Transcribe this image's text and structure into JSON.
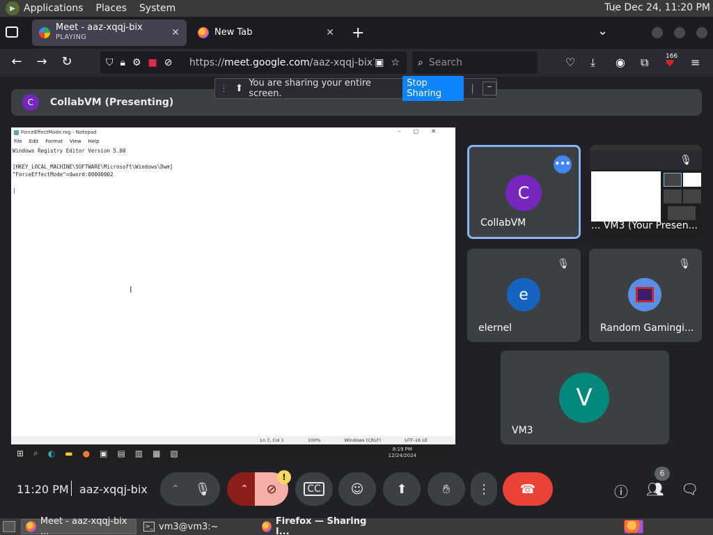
{
  "top_panel": {
    "menus": [
      "Applications",
      "Places",
      "System"
    ],
    "clock": "Tue Dec 24, 11:20 PM"
  },
  "browser": {
    "tabs": [
      {
        "title": "Meet - aaz-xqqj-bix",
        "subtitle": "PLAYING",
        "active": true
      },
      {
        "title": "New Tab",
        "active": false
      }
    ],
    "url_prefix": "https://",
    "url_host": "meet.google.com",
    "url_path": "/aaz-xqqj-bix?",
    "search_placeholder": "Search",
    "extensions_badge": "166"
  },
  "share_bar": {
    "message": "You are sharing your entire screen.",
    "stop_label": "Stop Sharing",
    "minimize_label": "–"
  },
  "presenting": {
    "avatar_letter": "C",
    "label": "CollabVM (Presenting)"
  },
  "shared_screen": {
    "window_title": "ForceEffectMode.reg - Notepad",
    "menu": [
      "File",
      "Edit",
      "Format",
      "View",
      "Help"
    ],
    "text": "Windows Registry Editor Version 5.00\n\n[HKEY_LOCAL_MACHINE\\SOFTWARE\\Microsoft\\Windows\\Dwm]\n\"ForceEffectMode\"=dword:00000002\n\n|",
    "status": [
      "Ln 7, Col 1",
      "100%",
      "Windows (CRLF)",
      "UTF-16 LE"
    ],
    "taskbar_time": "8:19 PM",
    "taskbar_date": "12/24/2024"
  },
  "tiles": [
    {
      "name": "CollabVM",
      "letter": "C",
      "color": "#7627bb",
      "selected": true
    },
    {
      "name": "... VM3 (Your Presen...",
      "kind": "screen"
    },
    {
      "name": "elernel",
      "letter": "e",
      "color": "#1565c0",
      "muted": true
    },
    {
      "name": "Random Gamingi...",
      "kind": "image",
      "muted": true
    },
    {
      "name": "VM3",
      "letter": "V",
      "color": "#00897b"
    }
  ],
  "bottom_bar": {
    "time": "11:20 PM",
    "meeting_code": "aaz-xqqj-bix",
    "participants_count": "6",
    "warning": "!"
  },
  "taskbar": {
    "items": [
      {
        "label": "Meet - aaz-xqqj-bix ...",
        "active": true
      },
      {
        "label": "vm3@vm3:~",
        "active": false
      },
      {
        "label": "Firefox — Sharing I...",
        "active": false
      }
    ]
  }
}
